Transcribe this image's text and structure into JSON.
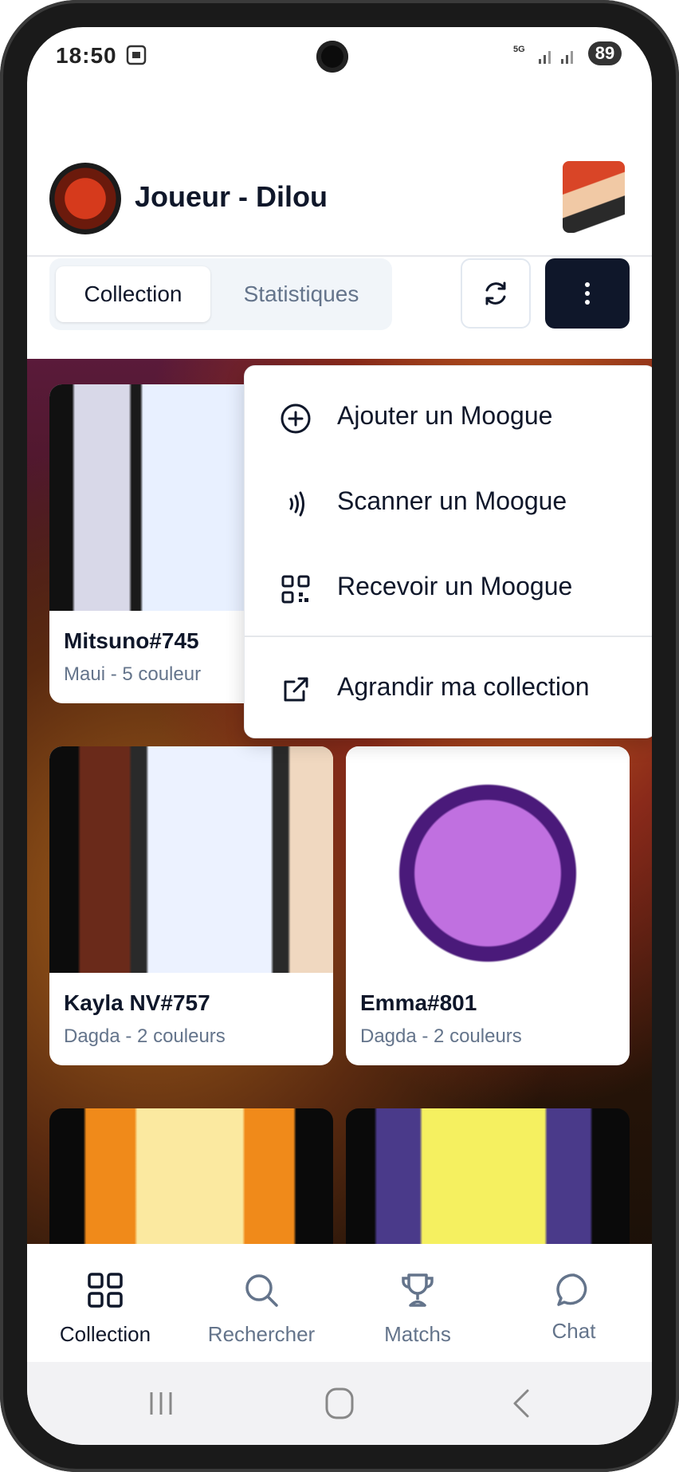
{
  "status_bar": {
    "time": "18:50",
    "network": "5G",
    "battery": "89"
  },
  "header": {
    "title": "Joueur - Dilou",
    "logo_icon": "team-logo",
    "avatar_icon": "user-avatar"
  },
  "tabs": [
    {
      "label": "Collection",
      "active": true
    },
    {
      "label": "Statistiques",
      "active": false
    }
  ],
  "toolbar": {
    "refresh_icon": "refresh-icon",
    "more_icon": "more-vertical-icon"
  },
  "menu": {
    "items": [
      {
        "label": "Ajouter un Moogue",
        "icon": "plus-circle-icon"
      },
      {
        "label": "Scanner un Moogue",
        "icon": "nfc-icon"
      },
      {
        "label": "Recevoir un Moogue",
        "icon": "qr-code-icon"
      },
      {
        "label": "Agrandir ma collection",
        "icon": "external-link-icon"
      }
    ]
  },
  "cards": [
    {
      "name": "Mitsuno#745",
      "subtitle": "Maui - 5 couleur"
    },
    {
      "name": "Kayla NV#757",
      "subtitle": "Dagda - 2 couleurs"
    },
    {
      "name": "Emma#801",
      "subtitle": "Dagda - 2 couleurs"
    }
  ],
  "bottom_nav": [
    {
      "label": "Collection",
      "icon": "grid-icon",
      "active": true
    },
    {
      "label": "Rechercher",
      "icon": "search-icon",
      "active": false
    },
    {
      "label": "Matchs",
      "icon": "trophy-icon",
      "active": false
    },
    {
      "label": "Chat",
      "icon": "chat-icon",
      "active": false
    }
  ],
  "colors": {
    "primary_dark": "#0f172a",
    "muted_text": "#64748b",
    "tab_bg": "#f1f5f9"
  }
}
